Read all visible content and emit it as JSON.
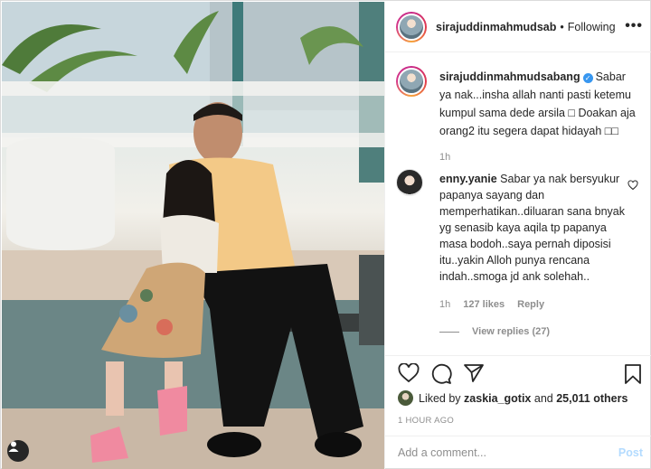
{
  "post": {
    "username": "sirajuddinmahmudsab",
    "follow_separator": "•",
    "follow_status": "Following",
    "more_label": "•••"
  },
  "caption": {
    "username": "sirajuddinmahmudsabang",
    "text": "Sabar ya nak...insha allah nanti pasti ketemu kumpul sama dede arsila □ Doakan aja orang2 itu segera dapat hidayah □□",
    "time": "1h"
  },
  "comment": {
    "username": "enny.yanie",
    "text": "Sabar ya nak bersyukur papanya sayang dan memperhatikan..diluaran sana bnyak yg senasib kaya aqila tp papanya masa bodoh..saya pernah diposisi itu..yakin Alloh punya rencana indah..smoga jd ank solehah..",
    "time": "1h",
    "likes": "127 likes",
    "reply_label": "Reply",
    "view_replies": "View replies (27)"
  },
  "likes": {
    "prefix": "Liked by",
    "user": "zaskia_gotix",
    "joiner": "and",
    "count": "25,011 others"
  },
  "time_ago": "1 HOUR AGO",
  "add_comment": {
    "placeholder": "Add a comment...",
    "post_label": "Post"
  },
  "colors": {
    "link_disabled": "#b3dbff",
    "verified": "#3897f0",
    "secondary_text": "#8e8e8e"
  }
}
